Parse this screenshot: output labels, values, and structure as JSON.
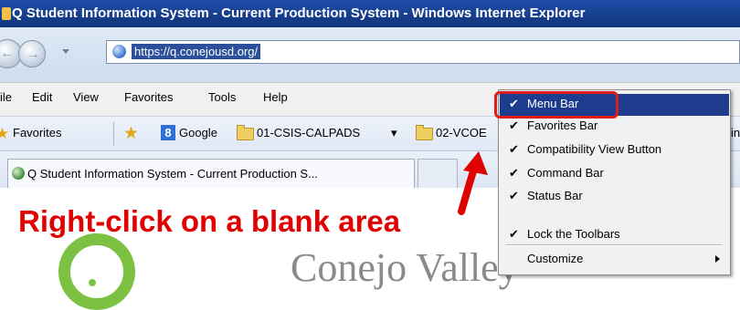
{
  "window": {
    "title": "Q Student Information System - Current Production System - Windows Internet Explorer"
  },
  "address_bar": {
    "url": "https://q.conejousd.org/"
  },
  "menu_bar": {
    "items": [
      "File",
      "Edit",
      "View",
      "Favorites",
      "Tools",
      "Help"
    ]
  },
  "favorites_bar": {
    "favorites_label": "Favorites",
    "links": [
      "Google",
      "01-CSIS-CALPADS",
      "02-VCOE"
    ],
    "dropdown_glyph": "▾",
    "overflow_text": "in"
  },
  "tab": {
    "label": "Q Student Information System - Current Production S..."
  },
  "page": {
    "instruction": "Right-click on a blank area",
    "heading_partial": "Conejo Valley"
  },
  "context_menu": {
    "items": [
      {
        "label": "Menu Bar",
        "checked": true,
        "selected": true
      },
      {
        "label": "Favorites Bar",
        "checked": true
      },
      {
        "label": "Compatibility View Button",
        "checked": true
      },
      {
        "label": "Command Bar",
        "checked": true
      },
      {
        "label": "Status Bar",
        "checked": true
      },
      {
        "label": "Lock the Toolbars",
        "checked": true
      },
      {
        "label": "Customize",
        "checked": false,
        "submenu": true
      }
    ],
    "check_glyph": "✔"
  },
  "colors": {
    "annotation_red": "#e00000",
    "title_bar_blue": "#173f8e",
    "selection_blue": "#1d3c8e",
    "logo_green": "#7dc142"
  }
}
